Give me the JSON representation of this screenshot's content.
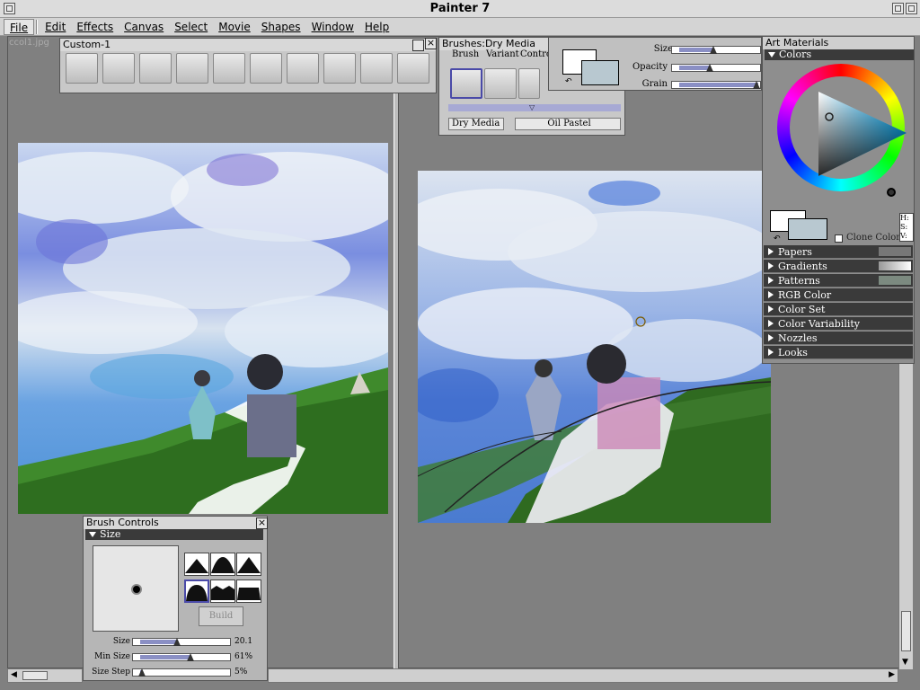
{
  "window": {
    "title": "Painter 7"
  },
  "menu": [
    "File",
    "Edit",
    "Effects",
    "Canvas",
    "Select",
    "Movie",
    "Shapes",
    "Window",
    "Help"
  ],
  "doc_tab": "ccol1.jpg",
  "custom_palette": {
    "title": "Custom-1"
  },
  "brushes": {
    "title": "Brushes:Dry Media",
    "tabs": [
      "Brush",
      "Variant",
      "Control"
    ],
    "category": "Dry Media",
    "variant": "Oil Pastel"
  },
  "property_bar": {
    "size_label": "Size",
    "opacity_label": "Opacity",
    "grain_label": "Grain"
  },
  "art_materials": {
    "title": "Art Materials",
    "colors_label": "Colors",
    "clone_color": "Clone Color",
    "hsv": [
      "H:",
      "S:",
      "V:"
    ],
    "sections": [
      "Papers",
      "Gradients",
      "Patterns",
      "RGB Color",
      "Color Set",
      "Color Variability",
      "Nozzles",
      "Looks"
    ]
  },
  "brush_controls": {
    "title": "Brush Controls",
    "section": "Size",
    "build_label": "Build",
    "rows": [
      {
        "label": "Size",
        "value": "20.1",
        "level": 0.48
      },
      {
        "label": "Min Size",
        "value": "61%",
        "level": 0.61
      },
      {
        "label": "Size Step",
        "value": "5%",
        "level": 0.05
      }
    ]
  },
  "colors": {
    "primary": "#ffffff",
    "secondary": "#b8c8d0",
    "panel_dark": "#3a3a3a",
    "slider_fill": "#8a8fc4"
  }
}
